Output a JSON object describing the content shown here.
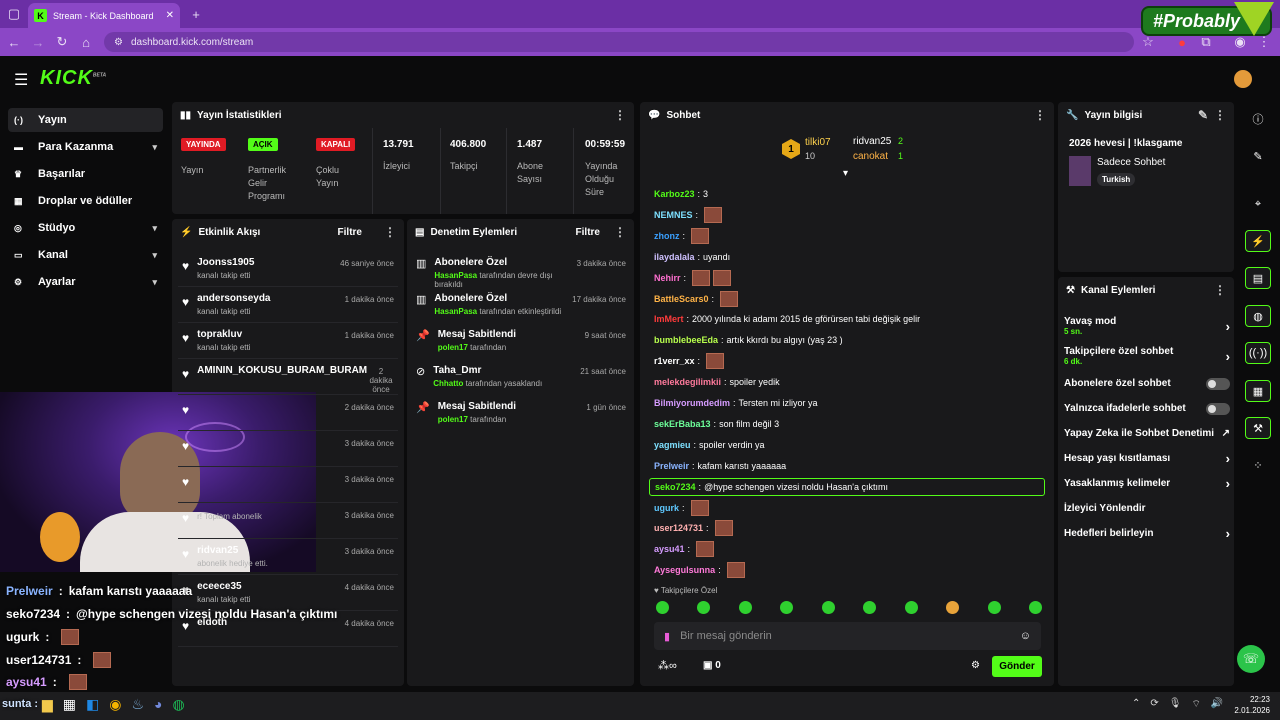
{
  "browser": {
    "tab_title": "Stream - Kick Dashboard",
    "url": "dashboard.kick.com/stream",
    "overlay_text": "#Probably"
  },
  "brand": {
    "logo": "KICK",
    "beta": "BETA",
    "accent": "#53fc18"
  },
  "sidebar": {
    "items": [
      {
        "label": "Yayın",
        "icon": "broadcast-icon"
      },
      {
        "label": "Para Kazanma",
        "icon": "money-icon",
        "chev": "▾"
      },
      {
        "label": "Başarılar",
        "icon": "trophy-icon"
      },
      {
        "label": "Droplar ve ödüller",
        "icon": "gift-icon"
      },
      {
        "label": "Stüdyo",
        "icon": "studio-icon",
        "chev": "▾"
      },
      {
        "label": "Kanal",
        "icon": "channel-icon",
        "chev": "▾"
      },
      {
        "label": "Ayarlar",
        "icon": "gear-icon",
        "chev": "▾"
      }
    ]
  },
  "stats": {
    "title": "Yayın İstatistikleri",
    "stream_badge": "YAYINDA",
    "stream_label": "Yayın",
    "partner_badge": "AÇIK",
    "partner_label": "Partnerlik Gelir Programı",
    "multi_badge": "KAPALI",
    "multi_label": "Çoklu Yayın",
    "viewers": "13.791",
    "viewers_label": "İzleyici",
    "followers": "406.800",
    "followers_label": "Takipçi",
    "subs": "1.487",
    "subs_label": "Abone Sayısı",
    "uptime": "00:59:59",
    "uptime_label": "Yayında Olduğu Süre"
  },
  "activity": {
    "title": "Etkinlik Akışı",
    "filter": "Filtre",
    "rows": [
      {
        "name": "Joonss1905",
        "sub": "kanalı takip etti",
        "time": "46 saniye önce"
      },
      {
        "name": "andersonseyda",
        "sub": "kanalı takip etti",
        "time": "1 dakika önce"
      },
      {
        "name": "toprakluv",
        "sub": "kanalı takip etti",
        "time": "1 dakika önce"
      },
      {
        "name": "AMININ_KOKUSU_BURAM_BURAM",
        "sub": "",
        "time": "2 dakika önce"
      },
      {
        "name": "",
        "sub": "",
        "time": "2 dakika önce"
      },
      {
        "name": "",
        "sub": "",
        "time": "3 dakika önce"
      },
      {
        "name": "",
        "sub": "",
        "time": "3 dakika önce"
      },
      {
        "name": "",
        "sub": "r! Toplam abonelik",
        "time": "3 dakika önce"
      },
      {
        "name": "ridvan25",
        "sub": "abonelik hediye etti.",
        "time": "3 dakika önce"
      },
      {
        "name": "eceece35",
        "sub": "kanalı takip etti",
        "time": "4 dakika önce"
      },
      {
        "name": "eldoth",
        "sub": "",
        "time": "4 dakika önce"
      }
    ]
  },
  "moderation": {
    "title": "Denetim Eylemleri",
    "filter": "Filtre",
    "rows": [
      {
        "name": "Abonelere Özel",
        "who": "HasanPasa",
        "sub": "tarafından devre dışı bırakıldı",
        "time": "3 dakika önce"
      },
      {
        "name": "Abonelere Özel",
        "who": "HasanPasa",
        "sub": "tarafından etkinleştirildi",
        "time": "17 dakika önce"
      },
      {
        "name": "Mesaj Sabitlendi",
        "who": "polen17",
        "sub": "tarafından",
        "time": "9 saat önce"
      },
      {
        "name": "Taha_Dmr",
        "who": "Chhatto",
        "sub": "tarafından yasaklandı",
        "time": "21 saat önce"
      },
      {
        "name": "Mesaj Sabitlendi",
        "who": "polen17",
        "sub": "tarafından",
        "time": "1 gün önce"
      }
    ]
  },
  "chat": {
    "title": "Sohbet",
    "top": [
      {
        "name": "tilki07",
        "count": "10"
      },
      {
        "name": "ridvan25",
        "count": "2"
      },
      {
        "name": "canokat",
        "count": "1"
      }
    ],
    "messages": [
      {
        "user": "Karboz23",
        "color": "#53fc18",
        "text": "3",
        "emotes": 0
      },
      {
        "user": "NEMNES",
        "color": "#7ee0ff",
        "text": "",
        "emotes": 1
      },
      {
        "user": "zhonz",
        "color": "#3aa0ff",
        "text": "",
        "emotes": 1
      },
      {
        "user": "ilaydalala",
        "color": "#cfc1ff",
        "text": "uyandı",
        "emotes": 0
      },
      {
        "user": "Nehirr",
        "color": "#ff6fd0",
        "text": "",
        "emotes": 2
      },
      {
        "user": "BattleScars0",
        "color": "#ffb347",
        "text": "",
        "emotes": 1
      },
      {
        "user": "ImMert",
        "color": "#ff3b3b",
        "text": "2000 yılında ki adamı 2015 de gförürsen tabi değişik gelir",
        "emotes": 0
      },
      {
        "user": "bumblebeeEda",
        "color": "#b8ff4d",
        "text": "artık kkırdı bu algıyı (yaş 23 )",
        "emotes": 0
      },
      {
        "user": "r1verr_xx",
        "color": "#ffffff",
        "text": "",
        "emotes": 1
      },
      {
        "user": "melekdegilimkii",
        "color": "#ff7a9c",
        "text": "spoiler yedik",
        "emotes": 0
      },
      {
        "user": "Bilmiyorumdedim",
        "color": "#d69cff",
        "text": "Tersten mi izliyor ya",
        "emotes": 0
      },
      {
        "user": "sekErBaba13",
        "color": "#6dff9a",
        "text": "son film değil 3",
        "emotes": 0
      },
      {
        "user": "yagmieu",
        "color": "#7ee0ff",
        "text": "spoiler verdin ya",
        "emotes": 0
      },
      {
        "user": "Prelweir",
        "color": "#8ab4ff",
        "text": "kafam karıstı yaaaaaa",
        "emotes": 0
      },
      {
        "user": "seko7234",
        "color": "#53fc18",
        "text": "@hype schengen vizesi noldu Hasan'a çıktımı",
        "emotes": 0,
        "hl": true
      },
      {
        "user": "ugurk",
        "color": "#5ec8ff",
        "text": "",
        "emotes": 1
      },
      {
        "user": "user124731",
        "color": "#ffb0b0",
        "text": "",
        "emotes": 1
      },
      {
        "user": "aysu41",
        "color": "#d69cff",
        "text": "",
        "emotes": 1
      },
      {
        "user": "Aysegulsunna",
        "color": "#ff7ad9",
        "text": "",
        "emotes": 1
      }
    ],
    "follower_only": "Takipçilere Özel",
    "placeholder": "Bir mesaj gönderin",
    "send": "Gönder",
    "points": "0"
  },
  "info": {
    "title": "Yayın bilgisi",
    "stream_title": "2026 hevesi | !klasgame",
    "category": "Sadece Sohbet",
    "tag": "Turkish"
  },
  "channel_actions": {
    "title": "Kanal Eylemleri",
    "items": [
      {
        "label": "Yavaş mod",
        "sub": "5 sn.",
        "kind": "arrow"
      },
      {
        "label": "Takipçilere özel sohbet",
        "sub": "6 dk.",
        "kind": "arrow"
      },
      {
        "label": "Abonelere özel sohbet",
        "sub": "",
        "kind": "toggle"
      },
      {
        "label": "Yalnızca ifadelerle sohbet",
        "sub": "",
        "kind": "toggle"
      },
      {
        "label": "Yapay Zeka ile Sohbet Denetimi",
        "sub": "",
        "kind": "ext"
      },
      {
        "label": "Hesap yaşı kısıtlaması",
        "sub": "",
        "kind": "arrow"
      },
      {
        "label": "Yasaklanmış kelimeler",
        "sub": "",
        "kind": "arrow"
      },
      {
        "label": "İzleyici Yönlendir",
        "sub": "",
        "kind": "none"
      },
      {
        "label": "Hedefleri belirleyin",
        "sub": "",
        "kind": "arrow"
      }
    ]
  },
  "overlay_chat": [
    {
      "user": "Prelweir",
      "color": "#8ab4ff",
      "text": "kafam karıstı yaaaaaa"
    },
    {
      "user": "seko7234",
      "color": "#ffffff",
      "text": "@hype schengen vizesi noldu Hasan'a çıktımı"
    },
    {
      "user": "ugurk",
      "color": "#ffffff",
      "text": ""
    },
    {
      "user": "user124731",
      "color": "#ffffff",
      "text": ""
    },
    {
      "user": "aysu41",
      "color": "#d69cff",
      "text": ""
    }
  ],
  "taskbar": {
    "time": "22:23",
    "date": "2.01.2026",
    "left_label": "sunta :"
  }
}
